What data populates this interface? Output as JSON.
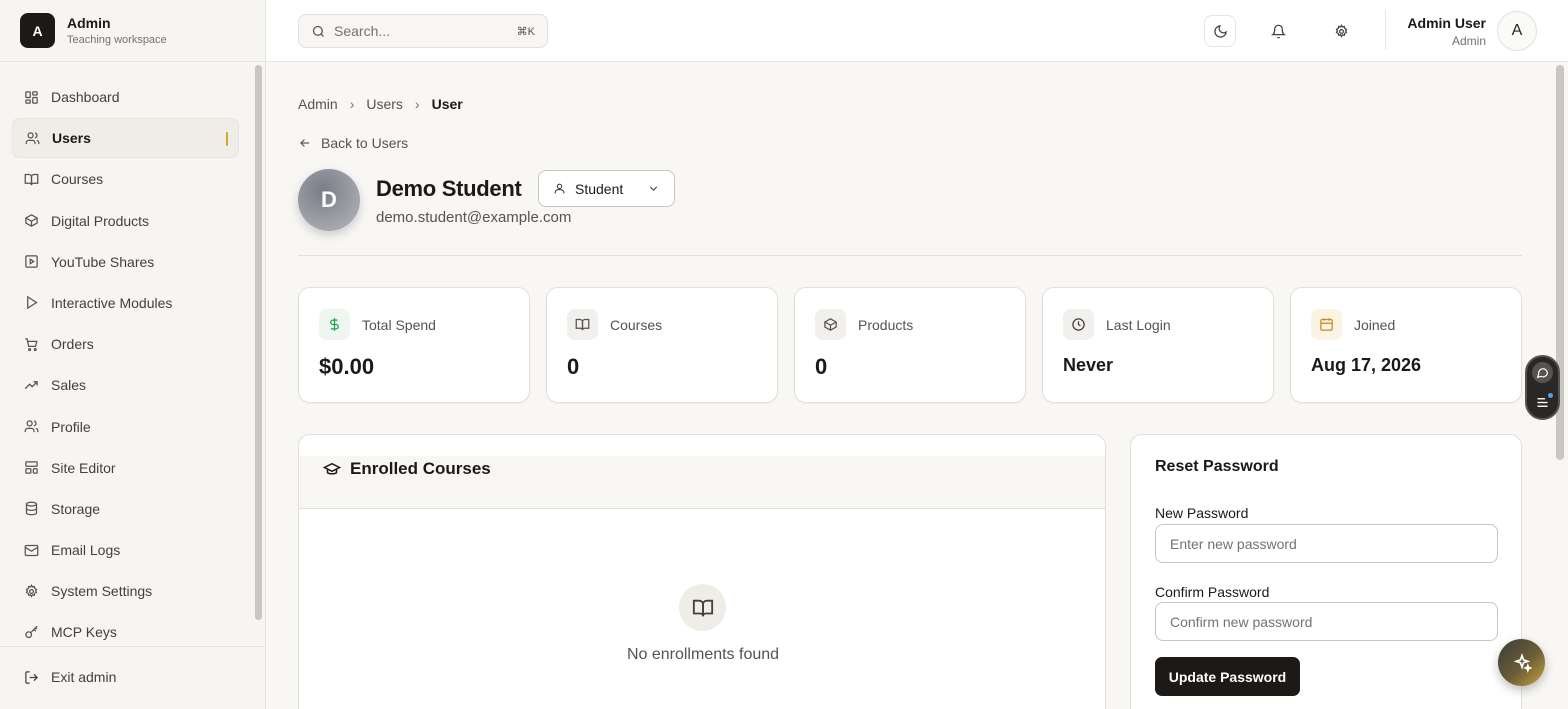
{
  "brand": {
    "logo_letter": "A",
    "title": "Admin",
    "subtitle": "Teaching workspace"
  },
  "sidebar": {
    "items": [
      {
        "label": "Dashboard",
        "icon": "dashboard-icon"
      },
      {
        "label": "Users",
        "icon": "users-icon",
        "active": true
      },
      {
        "label": "Courses",
        "icon": "book-icon"
      },
      {
        "label": "Digital Products",
        "icon": "package-icon"
      },
      {
        "label": "YouTube Shares",
        "icon": "video-icon"
      },
      {
        "label": "Interactive Modules",
        "icon": "play-icon"
      },
      {
        "label": "Orders",
        "icon": "cart-icon"
      },
      {
        "label": "Sales",
        "icon": "trending-icon"
      },
      {
        "label": "Profile",
        "icon": "users-icon"
      },
      {
        "label": "Site Editor",
        "icon": "layout-icon"
      },
      {
        "label": "Storage",
        "icon": "database-icon"
      },
      {
        "label": "Email Logs",
        "icon": "mail-icon"
      },
      {
        "label": "System Settings",
        "icon": "gear-icon"
      },
      {
        "label": "MCP Keys",
        "icon": "key-icon"
      }
    ],
    "exit_label": "Exit admin"
  },
  "header": {
    "search_placeholder": "Search...",
    "search_shortcut": "⌘K",
    "user_name": "Admin User",
    "user_role": "Admin",
    "avatar_letter": "A"
  },
  "breadcrumb": {
    "items": [
      "Admin",
      "Users"
    ],
    "current": "User"
  },
  "back_label": "Back to Users",
  "profile": {
    "avatar_letter": "D",
    "name": "Demo Student",
    "email": "demo.student@example.com",
    "role": "Student"
  },
  "stats": [
    {
      "label": "Total Spend",
      "value": "$0.00",
      "icon": "dollar-icon",
      "color": "#16a34a",
      "bg": "#eef6ef"
    },
    {
      "label": "Courses",
      "value": "0",
      "icon": "book-icon",
      "color": "#57534e",
      "bg": "#f1f0ec"
    },
    {
      "label": "Products",
      "value": "0",
      "icon": "package-icon",
      "color": "#57534e",
      "bg": "#f1f0ec"
    },
    {
      "label": "Last Login",
      "value": "Never",
      "icon": "clock-icon",
      "color": "#44403c",
      "bg": "#f1f0ec"
    },
    {
      "label": "Joined",
      "value": "Aug 17, 2026",
      "icon": "calendar-icon",
      "color": "#c58b1a",
      "bg": "#fbf4e4"
    }
  ],
  "enrolled": {
    "title": "Enrolled Courses",
    "empty_text": "No enrollments found"
  },
  "reset_password": {
    "title": "Reset Password",
    "new_label": "New Password",
    "new_placeholder": "Enter new password",
    "confirm_label": "Confirm Password",
    "confirm_placeholder": "Confirm new password",
    "button_label": "Update Password"
  }
}
